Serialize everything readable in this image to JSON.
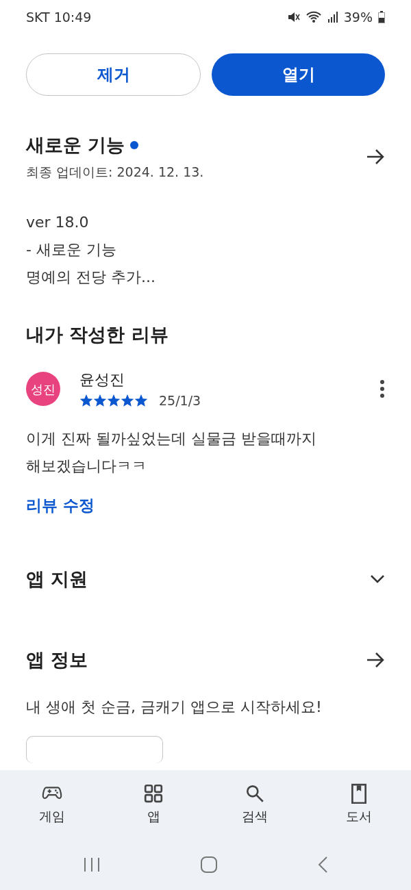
{
  "status_bar": {
    "carrier_time": "SKT 10:49",
    "battery": "39%"
  },
  "actions": [
    {
      "label": "제거",
      "kind": "outline"
    },
    {
      "label": "열기",
      "kind": "filled"
    }
  ],
  "whats_new": {
    "title": "새로운 기능",
    "new_indicator": true,
    "updated": "최종 업데이트: 2024. 12. 13.",
    "lines": [
      "ver 18.0",
      "- 새로운 기능",
      "명예의 전당 추가..."
    ]
  },
  "my_review": {
    "title": "내가 작성한 리뷰",
    "avatar": "성진",
    "name": "윤성진",
    "stars": 5,
    "date": "25/1/3",
    "text": "이게 진짜 될까싶었는데 실물금 받을때까지 해보겠습니다ㅋㅋ",
    "edit_link": "리뷰 수정"
  },
  "app_support": {
    "title": "앱 지원",
    "expanded": false
  },
  "app_info": {
    "title": "앱 정보",
    "description": "내 생애 첫 순금, 금캐기 앱으로 시작하세요!"
  },
  "bottom_nav": [
    {
      "label": "게임",
      "selected": false
    },
    {
      "label": "앱",
      "selected": false
    },
    {
      "label": "검색",
      "selected": false
    },
    {
      "label": "도서",
      "selected": false
    }
  ]
}
